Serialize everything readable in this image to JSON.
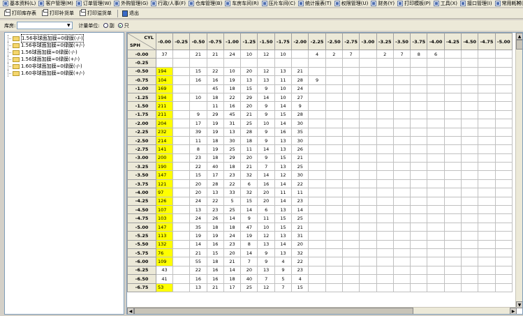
{
  "menu": {
    "items": [
      "基本资料(L)",
      "客户管理(M)",
      "订单管理(W)",
      "外购管理(G)",
      "行政/人事(F)",
      "仓库管理(B)",
      "车房车间(R)",
      "压片车间(C)",
      "统计报表(T)",
      "权限管理(U)",
      "财务(Y)",
      "打印模板(P)",
      "工具(X)",
      "接口管理(I)",
      "常用耗材(J)"
    ],
    "close": "✕"
  },
  "toolbar": {
    "buttons": [
      "打印库存表",
      "打印补货单",
      "打印溢货单"
    ],
    "exit": "退出"
  },
  "filter": {
    "warehouse_label": "库房:",
    "unit_label": "计量单位:",
    "option1": "副",
    "option2": "只"
  },
  "tree": {
    "items": [
      "1.56非球面加膜∞0绿膜(-/-)",
      "1.56非球面加膜∞0绿膜(+/-)",
      "1.56球面加膜∞0绿膜(-/-)",
      "1.56球面加膜∞0绿膜(+/-)",
      "1.60非球面加膜∞0绿膜(-/-)",
      "1.60非球面加膜∞0绿膜(+/-)"
    ]
  },
  "grid": {
    "cyl_label": "CYL",
    "sph_label": "SPH",
    "columns": [
      "-0.00",
      "-0.25",
      "-0.50",
      "-0.75",
      "-1.00",
      "-1.25",
      "-1.50",
      "-1.75",
      "-2.00",
      "-2.25",
      "-2.50",
      "-2.75",
      "-3.00",
      "-3.25",
      "-3.50",
      "-3.75",
      "-4.00",
      "-4.25",
      "-4.50",
      "-4.75",
      "-5.00"
    ],
    "rows": [
      {
        "sph": "-0.00",
        "v": [
          "37",
          "",
          "21",
          "21",
          "24",
          "10",
          "12",
          "10",
          "",
          "4",
          "2",
          "7",
          "",
          "2",
          "7",
          "8",
          "6",
          "",
          "",
          "",
          ""
        ],
        "hl": false
      },
      {
        "sph": "-0.25",
        "v": [
          "",
          "",
          "",
          "",
          "",
          "",
          "",
          "",
          "",
          "",
          "",
          "",
          "",
          "",
          "",
          "",
          "",
          "",
          "",
          "",
          ""
        ],
        "hl": false
      },
      {
        "sph": "-0.50",
        "v": [
          "194",
          "",
          "15",
          "22",
          "10",
          "20",
          "12",
          "13",
          "21",
          "",
          "",
          "",
          "",
          "",
          "",
          "",
          "",
          "",
          "",
          "",
          ""
        ],
        "hl": true
      },
      {
        "sph": "-0.75",
        "v": [
          "104",
          "",
          "16",
          "16",
          "19",
          "13",
          "13",
          "11",
          "28",
          "9",
          "",
          "",
          "",
          "",
          "",
          "",
          "",
          "",
          "",
          "",
          ""
        ],
        "hl": true
      },
      {
        "sph": "-1.00",
        "v": [
          "169",
          "",
          "",
          "45",
          "18",
          "15",
          "9",
          "10",
          "24",
          "",
          "",
          "",
          "",
          "",
          "",
          "",
          "",
          "",
          "",
          "",
          ""
        ],
        "hl": true
      },
      {
        "sph": "-1.25",
        "v": [
          "194",
          "",
          "10",
          "18",
          "22",
          "29",
          "14",
          "10",
          "27",
          "",
          "",
          "",
          "",
          "",
          "",
          "",
          "",
          "",
          "",
          "",
          ""
        ],
        "hl": true
      },
      {
        "sph": "-1.50",
        "v": [
          "211",
          "",
          "",
          "11",
          "16",
          "20",
          "9",
          "14",
          "9",
          "",
          "",
          "",
          "",
          "",
          "",
          "",
          "",
          "",
          "",
          "",
          ""
        ],
        "hl": true
      },
      {
        "sph": "-1.75",
        "v": [
          "211",
          "",
          "9",
          "29",
          "45",
          "21",
          "9",
          "15",
          "28",
          "",
          "",
          "",
          "",
          "",
          "",
          "",
          "",
          "",
          "",
          "",
          ""
        ],
        "hl": true
      },
      {
        "sph": "-2.00",
        "v": [
          "204",
          "",
          "17",
          "19",
          "31",
          "25",
          "10",
          "14",
          "30",
          "",
          "",
          "",
          "",
          "",
          "",
          "",
          "",
          "",
          "",
          "",
          ""
        ],
        "hl": true
      },
      {
        "sph": "-2.25",
        "v": [
          "232",
          "",
          "39",
          "19",
          "13",
          "28",
          "9",
          "16",
          "35",
          "",
          "",
          "",
          "",
          "",
          "",
          "",
          "",
          "",
          "",
          "",
          ""
        ],
        "hl": true
      },
      {
        "sph": "-2.50",
        "v": [
          "214",
          "",
          "11",
          "18",
          "30",
          "18",
          "9",
          "13",
          "30",
          "",
          "",
          "",
          "",
          "",
          "",
          "",
          "",
          "",
          "",
          "",
          ""
        ],
        "hl": true
      },
      {
        "sph": "-2.75",
        "v": [
          "141",
          "",
          "8",
          "19",
          "25",
          "11",
          "14",
          "13",
          "26",
          "",
          "",
          "",
          "",
          "",
          "",
          "",
          "",
          "",
          "",
          "",
          ""
        ],
        "hl": true
      },
      {
        "sph": "-3.00",
        "v": [
          "200",
          "",
          "23",
          "18",
          "29",
          "20",
          "9",
          "15",
          "21",
          "",
          "",
          "",
          "",
          "",
          "",
          "",
          "",
          "",
          "",
          "",
          ""
        ],
        "hl": true
      },
      {
        "sph": "-3.25",
        "v": [
          "190",
          "",
          "22",
          "40",
          "18",
          "21",
          "7",
          "13",
          "25",
          "",
          "",
          "",
          "",
          "",
          "",
          "",
          "",
          "",
          "",
          "",
          ""
        ],
        "hl": true
      },
      {
        "sph": "-3.50",
        "v": [
          "147",
          "",
          "15",
          "17",
          "23",
          "32",
          "14",
          "12",
          "30",
          "",
          "",
          "",
          "",
          "",
          "",
          "",
          "",
          "",
          "",
          "",
          ""
        ],
        "hl": true
      },
      {
        "sph": "-3.75",
        "v": [
          "121",
          "",
          "20",
          "28",
          "22",
          "6",
          "16",
          "14",
          "22",
          "",
          "",
          "",
          "",
          "",
          "",
          "",
          "",
          "",
          "",
          "",
          ""
        ],
        "hl": true
      },
      {
        "sph": "-4.00",
        "v": [
          "97",
          "",
          "20",
          "13",
          "33",
          "32",
          "20",
          "11",
          "11",
          "",
          "",
          "",
          "",
          "",
          "",
          "",
          "",
          "",
          "",
          "",
          ""
        ],
        "hl": true
      },
      {
        "sph": "-4.25",
        "v": [
          "126",
          "",
          "24",
          "22",
          "5",
          "15",
          "20",
          "14",
          "23",
          "",
          "",
          "",
          "",
          "",
          "",
          "",
          "",
          "",
          "",
          "",
          ""
        ],
        "hl": true
      },
      {
        "sph": "-4.50",
        "v": [
          "107",
          "",
          "13",
          "23",
          "25",
          "14",
          "6",
          "13",
          "14",
          "",
          "",
          "",
          "",
          "",
          "",
          "",
          "",
          "",
          "",
          "",
          ""
        ],
        "hl": true
      },
      {
        "sph": "-4.75",
        "v": [
          "103",
          "",
          "24",
          "26",
          "14",
          "9",
          "11",
          "15",
          "25",
          "",
          "",
          "",
          "",
          "",
          "",
          "",
          "",
          "",
          "",
          "",
          ""
        ],
        "hl": true
      },
      {
        "sph": "-5.00",
        "v": [
          "147",
          "",
          "35",
          "18",
          "18",
          "47",
          "10",
          "15",
          "21",
          "",
          "",
          "",
          "",
          "",
          "",
          "",
          "",
          "",
          "",
          "",
          ""
        ],
        "hl": true
      },
      {
        "sph": "-5.25",
        "v": [
          "113",
          "",
          "19",
          "19",
          "24",
          "19",
          "12",
          "13",
          "31",
          "",
          "",
          "",
          "",
          "",
          "",
          "",
          "",
          "",
          "",
          "",
          ""
        ],
        "hl": true
      },
      {
        "sph": "-5.50",
        "v": [
          "132",
          "",
          "14",
          "16",
          "23",
          "8",
          "13",
          "14",
          "20",
          "",
          "",
          "",
          "",
          "",
          "",
          "",
          "",
          "",
          "",
          "",
          ""
        ],
        "hl": true
      },
      {
        "sph": "-5.75",
        "v": [
          "76",
          "",
          "21",
          "15",
          "20",
          "14",
          "9",
          "13",
          "32",
          "",
          "",
          "",
          "",
          "",
          "",
          "",
          "",
          "",
          "",
          "",
          ""
        ],
        "hl": true
      },
      {
        "sph": "-6.00",
        "v": [
          "109",
          "",
          "55",
          "18",
          "21",
          "7",
          "9",
          "4",
          "22",
          "",
          "",
          "",
          "",
          "",
          "",
          "",
          "",
          "",
          "",
          "",
          ""
        ],
        "hl": true
      },
      {
        "sph": "-6.25",
        "v": [
          "43",
          "",
          "22",
          "16",
          "14",
          "20",
          "13",
          "9",
          "23",
          "",
          "",
          "",
          "",
          "",
          "",
          "",
          "",
          "",
          "",
          "",
          ""
        ],
        "hl": false
      },
      {
        "sph": "-6.50",
        "v": [
          "41",
          "",
          "16",
          "16",
          "18",
          "40",
          "7",
          "5",
          "4",
          "",
          "",
          "",
          "",
          "",
          "",
          "",
          "",
          "",
          "",
          "",
          ""
        ],
        "hl": false
      },
      {
        "sph": "-6.75",
        "v": [
          "53",
          "",
          "13",
          "21",
          "17",
          "25",
          "12",
          "7",
          "15",
          "",
          "",
          "",
          "",
          "",
          "",
          "",
          "",
          "",
          "",
          "",
          ""
        ],
        "hl": true
      }
    ]
  },
  "colors": {
    "highlight": "#ffff00",
    "header_bg": "#ece9d8"
  }
}
